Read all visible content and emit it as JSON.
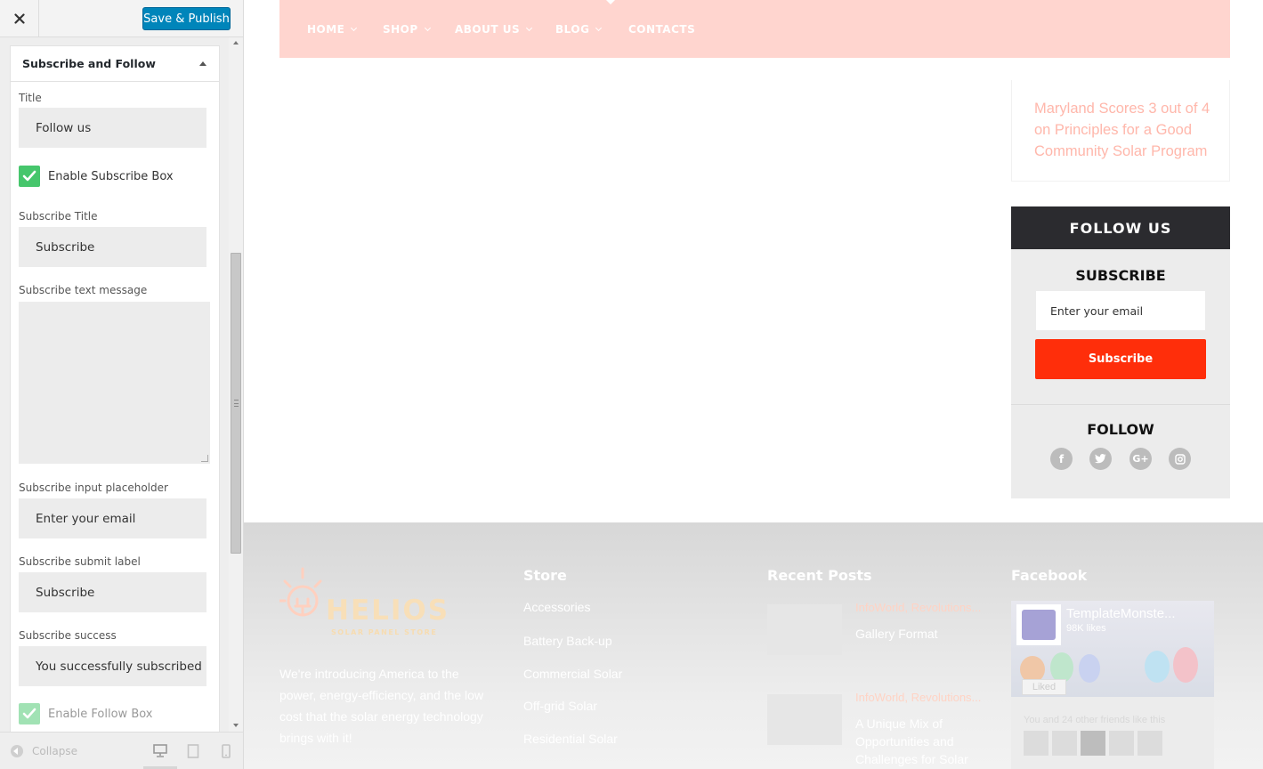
{
  "customizer": {
    "save_label": "Save & Publish",
    "section_title": "Subscribe and Follow",
    "fields": {
      "title_label": "Title",
      "title_value": "Follow us",
      "enable_subscribe_label": "Enable Subscribe Box",
      "enable_subscribe_checked": true,
      "subscribe_title_label": "Subscribe Title",
      "subscribe_title_value": "Subscribe",
      "subscribe_text_label": "Subscribe text message",
      "subscribe_text_value": "",
      "placeholder_label": "Subscribe input placeholder",
      "placeholder_value": "Enter your email",
      "submit_label": "Subscribe submit label",
      "submit_value": "Subscribe",
      "success_label": "Subscribe success",
      "success_value": "You successfully subscribed",
      "enable_follow_label": "Enable Follow Box",
      "enable_follow_checked": true
    },
    "footer": {
      "collapse_label": "Collapse",
      "active_device": "desktop"
    }
  },
  "preview": {
    "nav": [
      {
        "label": "HOME",
        "has_dropdown": true
      },
      {
        "label": "SHOP",
        "has_dropdown": true
      },
      {
        "label": "ABOUT US",
        "has_dropdown": true
      },
      {
        "label": "BLOG",
        "has_dropdown": true
      },
      {
        "label": "CONTACTS",
        "has_dropdown": false
      }
    ],
    "post_link": "Maryland Scores 3 out of 4 on Principles for a Good Community Solar Program",
    "follow_widget": {
      "title": "FOLLOW US",
      "subscribe_title": "SUBSCRIBE",
      "email_placeholder": "Enter your email",
      "subscribe_button": "Subscribe",
      "follow_title": "FOLLOW",
      "social_icons": [
        "facebook-icon",
        "twitter-icon",
        "google-plus-icon",
        "instagram-icon"
      ]
    },
    "footer": {
      "logo_text": "HELIOS",
      "logo_tagline": "SOLAR PANEL STORE",
      "about_text": "We're introducing America to the power, energy-efficiency, and the low cost that the solar energy technology brings with it!",
      "store_heading": "Store",
      "store_links": [
        "Accessories",
        "Battery Back-up",
        "Commercial Solar",
        "Off-grid Solar",
        "Residential Solar"
      ],
      "recent_heading": "Recent Posts",
      "recent_posts": [
        {
          "category": "InfoWorld, Revolutions...",
          "title": "Gallery Format"
        },
        {
          "category": "InfoWorld, Revolutions...",
          "title": "A Unique Mix of Opportunities and Challenges for Solar"
        }
      ],
      "facebook_heading": "Facebook",
      "facebook": {
        "page_name": "TemplateMonste...",
        "likes": "98K likes",
        "liked_label": "Liked",
        "friends_text": "You and 24 other friends like this"
      }
    }
  },
  "colors": {
    "nav_bg": "#ffd5cf",
    "accent_red": "#ff2e0a",
    "dark_header": "#2b2b2f",
    "save_button": "#0085ba",
    "checkbox_green": "#46c66c",
    "post_link": "#ffb7ab"
  }
}
